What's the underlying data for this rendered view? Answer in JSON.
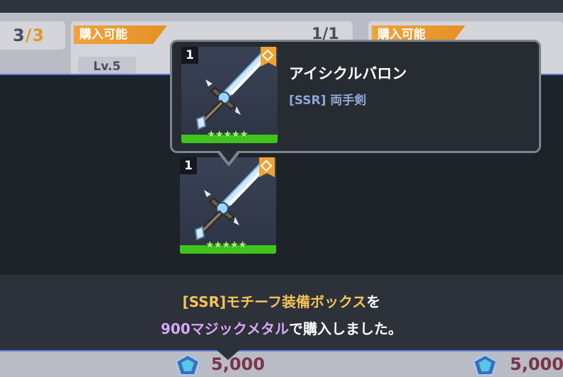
{
  "shop": {
    "left_count": "3",
    "left_max": "3",
    "card1_tag": "購入可能",
    "card1_count": "1/1",
    "card1_level": "Lv.5",
    "card2_tag": "購入可能",
    "card1_price": "5,000",
    "card2_price": "5,000"
  },
  "tooltip": {
    "item_name": "アイシクルバロン",
    "item_type": "[SSR] 両手剣",
    "quantity": "1",
    "stars": "★★★★★",
    "star_count": 5
  },
  "reward_item": {
    "quantity": "1",
    "stars": "★★★★★",
    "star_count": 5
  },
  "message": {
    "part1_highlight": "[SSR]モチーフ装備ボックス",
    "part1_suffix": "を",
    "part2_highlight": "900マジックメタル",
    "part2_suffix": "で購入しました。"
  },
  "colors": {
    "accent_orange": "#f0a331",
    "highlight_gold": "#f3c35a",
    "highlight_purple": "#d9a6f5",
    "grass_green": "#3fc41c",
    "price_text": "#7a3548"
  }
}
